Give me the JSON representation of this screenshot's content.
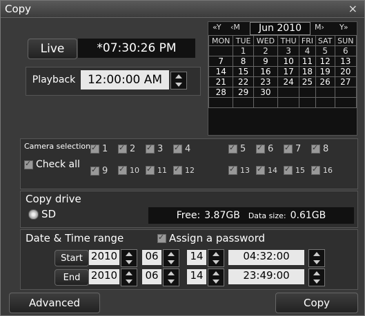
{
  "window": {
    "title": "Copy",
    "close": "×"
  },
  "live": {
    "button": "Live",
    "time": "*07:30:26 PM"
  },
  "playback": {
    "button": "Playback",
    "time": "12:00:00 AM"
  },
  "calendar": {
    "nav": {
      "prev_year": "«Y",
      "prev_month": "‹M",
      "next_month": "M›",
      "next_year": "Y»"
    },
    "month_label": "Jun 2010",
    "weekdays": [
      "MON",
      "TUE",
      "WED",
      "THU",
      "FRI",
      "SAT",
      "SUN"
    ],
    "weeks": [
      [
        "",
        "1",
        "2",
        "3",
        "4",
        "5",
        "6"
      ],
      [
        "7",
        "8",
        "9",
        "10",
        "11",
        "12",
        "13"
      ],
      [
        "14",
        "15",
        "16",
        "17",
        "18",
        "19",
        "20"
      ],
      [
        "21",
        "22",
        "23",
        "24",
        "25",
        "26",
        "27"
      ],
      [
        "28",
        "29",
        "30",
        "",
        "",
        "",
        ""
      ],
      [
        "",
        "",
        "",
        "",
        "",
        "",
        ""
      ]
    ]
  },
  "camera": {
    "label": "Camera selection",
    "check_all": "Check all",
    "cameras": [
      "1",
      "2",
      "3",
      "4",
      "5",
      "6",
      "7",
      "8",
      "9",
      "10",
      "11",
      "12",
      "13",
      "14",
      "15",
      "16"
    ]
  },
  "copy_drive": {
    "label": "Copy drive",
    "option": "SD",
    "free_label": "Free:",
    "free_value": "3.87GB",
    "data_size_label": "Data size:",
    "data_size_value": "0.61GB"
  },
  "range": {
    "label": "Date & Time range",
    "assign_password": "Assign a password",
    "start": {
      "label": "Start",
      "year": "2010",
      "month": "06",
      "day": "14",
      "time": "04:32:00"
    },
    "end": {
      "label": "End",
      "year": "2010",
      "month": "06",
      "day": "14",
      "time": "23:49:00"
    }
  },
  "footer": {
    "advanced": "Advanced",
    "copy": "Copy"
  }
}
